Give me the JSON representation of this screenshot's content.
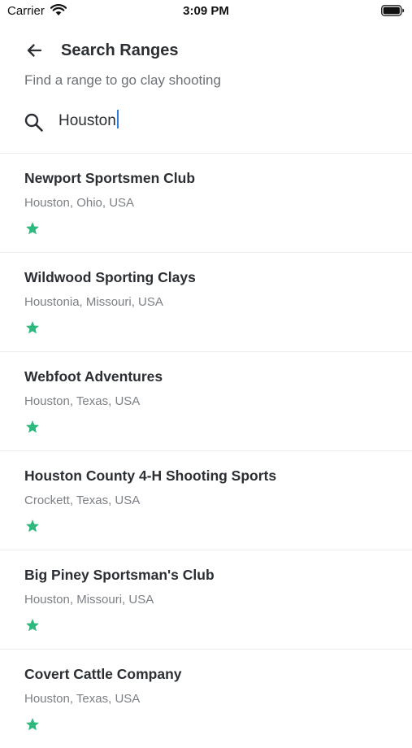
{
  "status_bar": {
    "carrier": "Carrier",
    "time": "3:09 PM"
  },
  "header": {
    "title": "Search Ranges",
    "back_icon": "arrow-left-icon"
  },
  "subtitle": "Find a range to go clay shooting",
  "search": {
    "value": "Houston",
    "icon": "search-icon"
  },
  "colors": {
    "star": "#2db87d",
    "caret": "#2f7de1",
    "title_text": "#2b2f33",
    "secondary_text": "#7c8085"
  },
  "results": [
    {
      "name": "Newport Sportsmen Club",
      "location": "Houston, Ohio, USA"
    },
    {
      "name": "Wildwood Sporting Clays",
      "location": "Houstonia, Missouri, USA"
    },
    {
      "name": "Webfoot Adventures",
      "location": "Houston, Texas, USA"
    },
    {
      "name": "Houston County 4-H Shooting Sports",
      "location": "Crockett, Texas, USA"
    },
    {
      "name": "Big Piney Sportsman's Club",
      "location": "Houston, Missouri, USA"
    },
    {
      "name": "Covert Cattle Company",
      "location": "Houston, Texas, USA"
    }
  ]
}
